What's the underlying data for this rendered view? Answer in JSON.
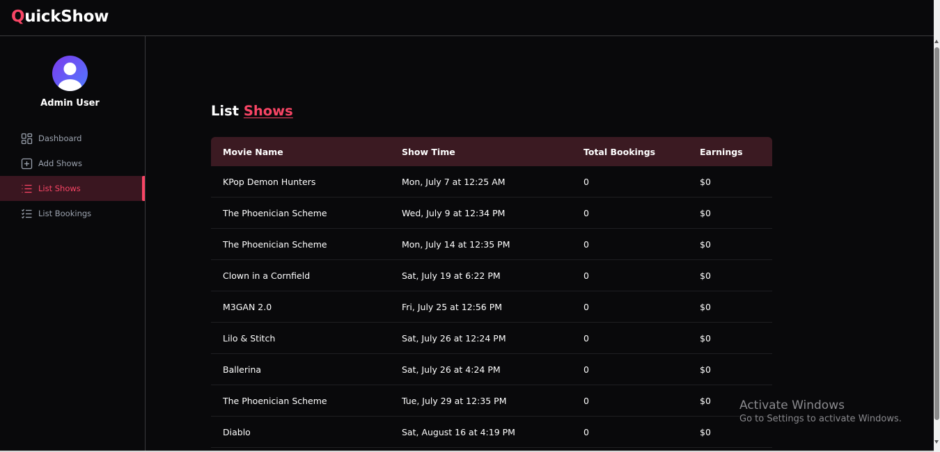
{
  "header": {
    "logo_first_letter": "Q",
    "logo_rest": "uickShow"
  },
  "sidebar": {
    "user_name": "Admin User",
    "items": [
      {
        "label": "Dashboard",
        "icon": "dashboard-grid-icon",
        "active": false
      },
      {
        "label": "Add Shows",
        "icon": "plus-square-icon",
        "active": false
      },
      {
        "label": "List Shows",
        "icon": "list-icon",
        "active": true
      },
      {
        "label": "List Bookings",
        "icon": "list-checks-icon",
        "active": false
      }
    ]
  },
  "main": {
    "title_prefix": "List",
    "title_accent": "Shows",
    "table": {
      "headers": [
        "Movie Name",
        "Show Time",
        "Total Bookings",
        "Earnings"
      ],
      "rows": [
        [
          "KPop Demon Hunters",
          "Mon, July 7 at 12:25 AM",
          "0",
          "$0"
        ],
        [
          "The Phoenician Scheme",
          "Wed, July 9 at 12:34 PM",
          "0",
          "$0"
        ],
        [
          "The Phoenician Scheme",
          "Mon, July 14 at 12:35 PM",
          "0",
          "$0"
        ],
        [
          "Clown in a Cornfield",
          "Sat, July 19 at 6:22 PM",
          "0",
          "$0"
        ],
        [
          "M3GAN 2.0",
          "Fri, July 25 at 12:56 PM",
          "0",
          "$0"
        ],
        [
          "Lilo & Stitch",
          "Sat, July 26 at 12:24 PM",
          "0",
          "$0"
        ],
        [
          "Ballerina",
          "Sat, July 26 at 4:24 PM",
          "0",
          "$0"
        ],
        [
          "The Phoenician Scheme",
          "Tue, July 29 at 12:35 PM",
          "0",
          "$0"
        ],
        [
          "Diablo",
          "Sat, August 16 at 4:19 PM",
          "0",
          "$0"
        ]
      ]
    }
  },
  "watermark": {
    "line1": "Activate Windows",
    "line2": "Go to Settings to activate Windows."
  },
  "colors": {
    "accent": "#f84565",
    "background": "#09090b",
    "table_header_bg": "#3b1a22",
    "active_nav_bg": "#3a1620"
  }
}
